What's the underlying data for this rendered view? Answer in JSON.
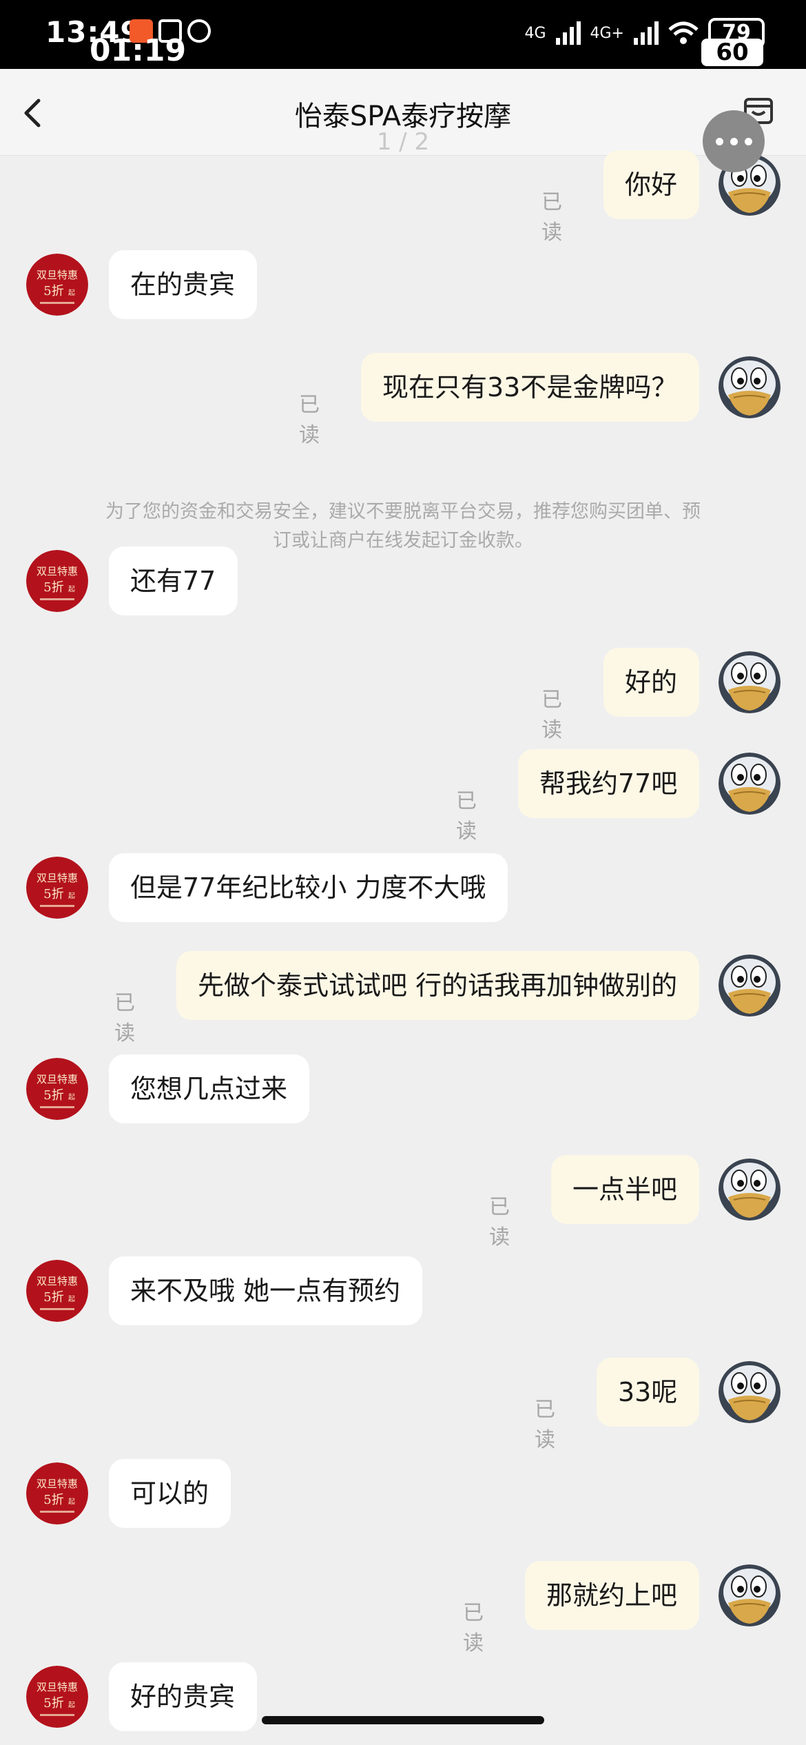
{
  "status_bar": {
    "time": "13:49",
    "overlay_time": "01:19",
    "network_left": "4G",
    "network_right": "4G+",
    "battery": "79",
    "refresh_rate": "60"
  },
  "header": {
    "title": "怡泰SPA泰疗按摩",
    "page_indicator": "1 / 2"
  },
  "notice": "为了您的资金和交易安全，建议不要脱离平台交易，推荐您购买团单、预订或让商户在线发起订金收款。",
  "read_label": "已读",
  "messages": [
    {
      "side": "out",
      "text": "你好",
      "read": "已读"
    },
    {
      "side": "in",
      "text": "在的贵宾"
    },
    {
      "side": "out",
      "text": "现在只有33不是金牌吗？",
      "read": "已读"
    },
    {
      "side": "in",
      "text": "还有77"
    },
    {
      "side": "out",
      "text": "好的",
      "read": "已读"
    },
    {
      "side": "out",
      "text": "帮我约77吧",
      "read": "已读"
    },
    {
      "side": "in",
      "text": "但是77年纪比较小 力度不大哦"
    },
    {
      "side": "out",
      "text": "先做个泰式试试吧 行的话我再加钟做别的",
      "read": "已读"
    },
    {
      "side": "in",
      "text": "您想几点过来"
    },
    {
      "side": "out",
      "text": "一点半吧",
      "read": "已读"
    },
    {
      "side": "in",
      "text": "来不及哦 她一点有预约"
    },
    {
      "side": "out",
      "text": "33呢",
      "read": "已读"
    },
    {
      "side": "in",
      "text": "可以的"
    },
    {
      "side": "out",
      "text": "那就约上吧",
      "read": "已读"
    },
    {
      "side": "in",
      "text": "好的贵宾"
    }
  ],
  "merchant_avatar": {
    "line1": "双旦特惠",
    "line2": "5折",
    "line3": "起",
    "color": "#b3121c"
  },
  "colors": {
    "outgoing_bubble": "#fdf8e6",
    "incoming_bubble": "#ffffff",
    "background": "#efefef"
  }
}
